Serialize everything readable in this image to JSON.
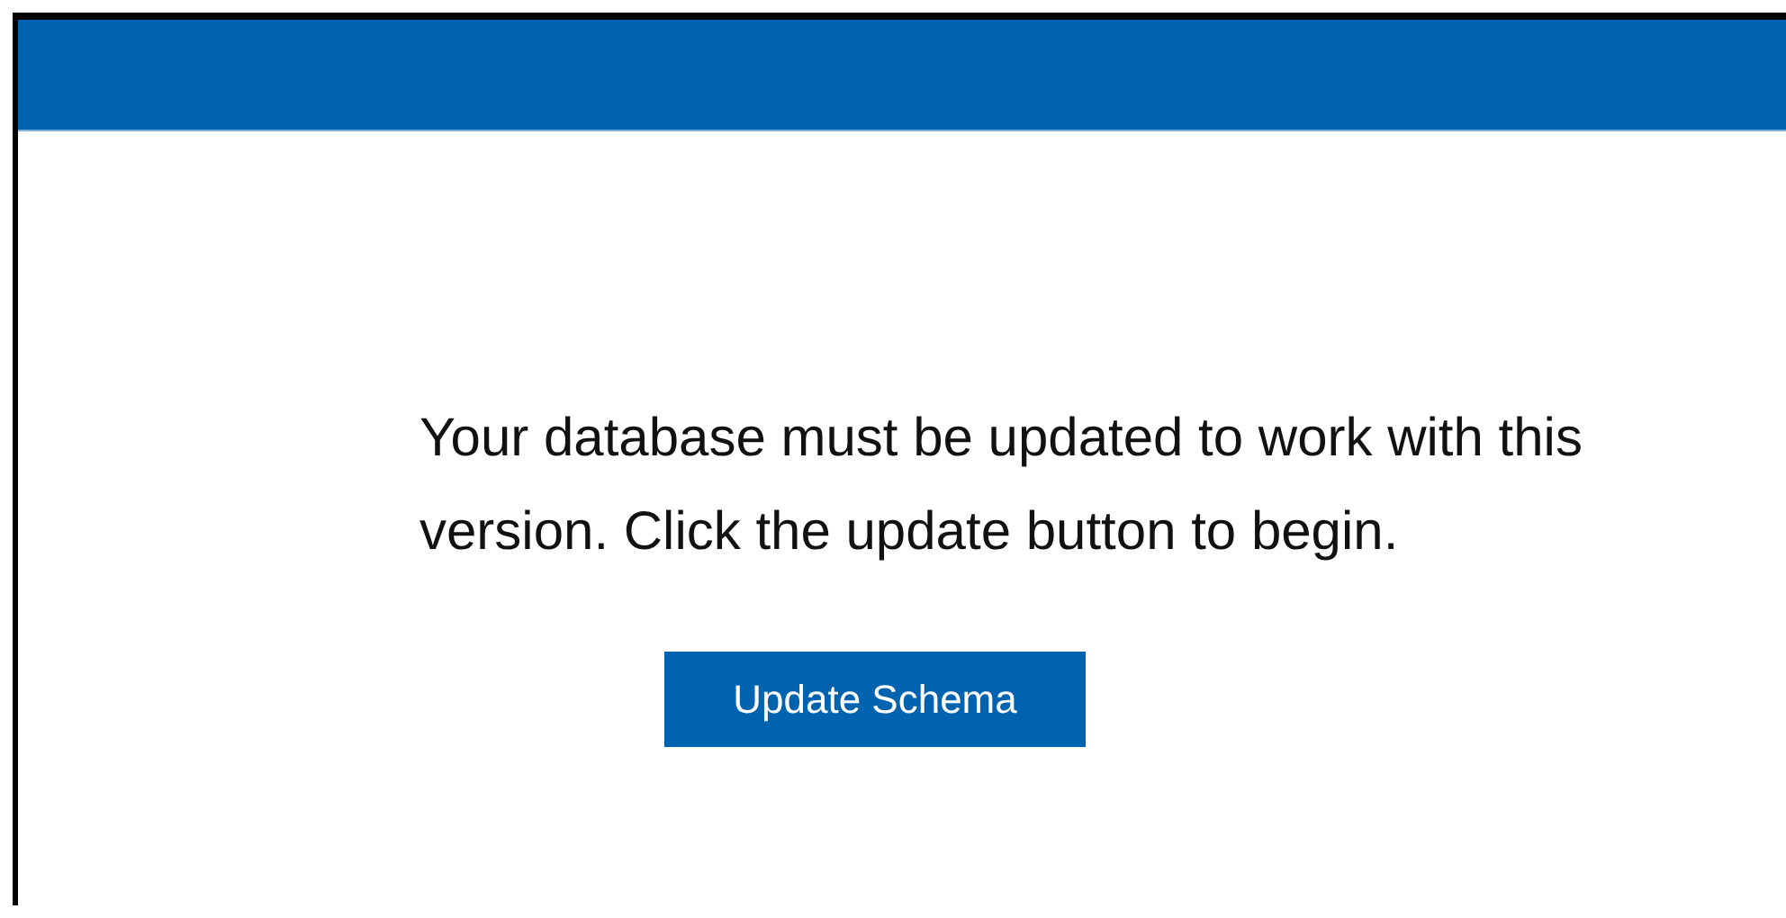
{
  "message": "Your database must be updated to work with this version. Click the update button to begin.",
  "button": {
    "label": "Update Schema"
  }
}
